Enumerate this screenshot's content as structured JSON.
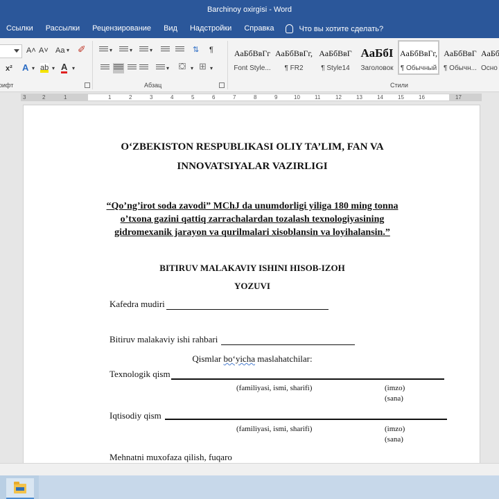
{
  "window": {
    "title": "Barchinoy oxirgisi  -  Word"
  },
  "ribbon_tabs": [
    "Ссылки",
    "Рассылки",
    "Рецензирование",
    "Вид",
    "Надстройки",
    "Справка"
  ],
  "tell_me": "Что вы хотите сделать?",
  "groups": {
    "font": "рифт",
    "paragraph": "Абзац",
    "styles": "Стили"
  },
  "font_controls": {
    "grow": "A˄",
    "shrink": "A˅",
    "case": "Aa",
    "superscript": "x²",
    "effects": "A",
    "highlight": "ab",
    "color": "A"
  },
  "styles": [
    {
      "preview": "АаБбВвГг",
      "name": "Font Style..."
    },
    {
      "preview": "АаБбВвГг,",
      "name": "¶ FR2"
    },
    {
      "preview": "АаБбВвГ",
      "name": "¶ Style14"
    },
    {
      "preview": "АаБбІ",
      "name": "Заголовок"
    },
    {
      "preview": "АаБбВвГг,",
      "name": "¶ Обычный"
    },
    {
      "preview": "АаБбВвГ",
      "name": "¶ Обычн..."
    },
    {
      "preview": "АаБбВ",
      "name": "Осно"
    }
  ],
  "ruler": {
    "left_numbers": [
      "3",
      "2",
      "1"
    ],
    "right_numbers": [
      "1",
      "2",
      "3",
      "4",
      "5",
      "6",
      "7",
      "8",
      "9",
      "10",
      "11",
      "12",
      "13",
      "14",
      "15",
      "16",
      "17"
    ]
  },
  "document": {
    "ministry_line1": "O‘ZBEKISTON    RESPUBLIKASI OLIY  TA’LIM, FAN VA",
    "ministry_line2": "INNOVATSIYALAR VAZIRLIGI",
    "topic_line1": "“Qo’ng’irot soda zavodi” MChJ da unumdorligi yiliga 180 ming tonna",
    "topic_line2": "o’txona gazini qattiq zarrachalardan  tozalash texnologiyasining",
    "topic_line3": "gidromexanik jarayon va qurilmalari xisoblansin va loyihalansin.”",
    "doc_type_line1": "BITIRUV MALAKAVIY ISHINI HISOB-IZOH",
    "doc_type_line2": "YOZUVI",
    "head_of_department": "Kafedra mudiri",
    "thesis_supervisor": "Bitiruv malakaviy ishi rahbari",
    "consultants_prefix": "Qismlar ",
    "consultants_word": "bo‘yicha",
    "consultants_suffix": " maslahatchilar:",
    "technological_part": "Texnologik qism",
    "economic_part": "Iqtisodiy qism",
    "fio_hint": "(familiyasi, ismi, sharifi)",
    "signature_hint": "(imzo)",
    "date_hint": "(sana)",
    "labor_protection": "Mehnatni muxofaza qilish, fuqaro"
  }
}
